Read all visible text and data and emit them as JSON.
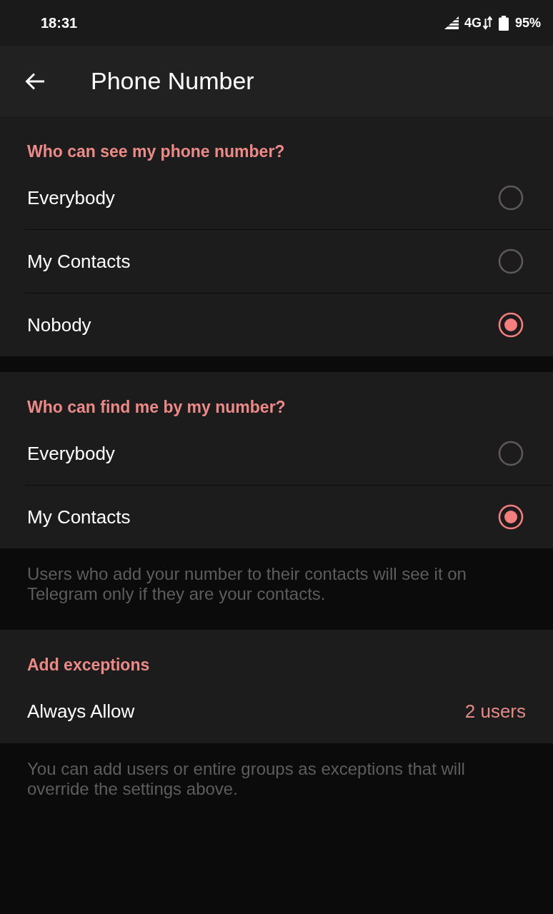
{
  "status_bar": {
    "time": "18:31",
    "network": "4G",
    "battery": "95%"
  },
  "app_bar": {
    "title": "Phone Number"
  },
  "sections": [
    {
      "kind": "radio",
      "header": "Who can see my phone number?",
      "options": [
        {
          "label": "Everybody",
          "selected": false
        },
        {
          "label": "My Contacts",
          "selected": false
        },
        {
          "label": "Nobody",
          "selected": true
        }
      ]
    },
    {
      "kind": "radio",
      "header": "Who can find me by my number?",
      "options": [
        {
          "label": "Everybody",
          "selected": false
        },
        {
          "label": "My Contacts",
          "selected": true
        }
      ],
      "footnote": "Users who add your number to their contacts will see it on Telegram only if they are your contacts."
    },
    {
      "kind": "links",
      "header": "Add exceptions",
      "rows": [
        {
          "label": "Always Allow",
          "value": "2 users"
        }
      ],
      "footnote": "You can add users or entire groups as exceptions that will override the settings above."
    }
  ]
}
